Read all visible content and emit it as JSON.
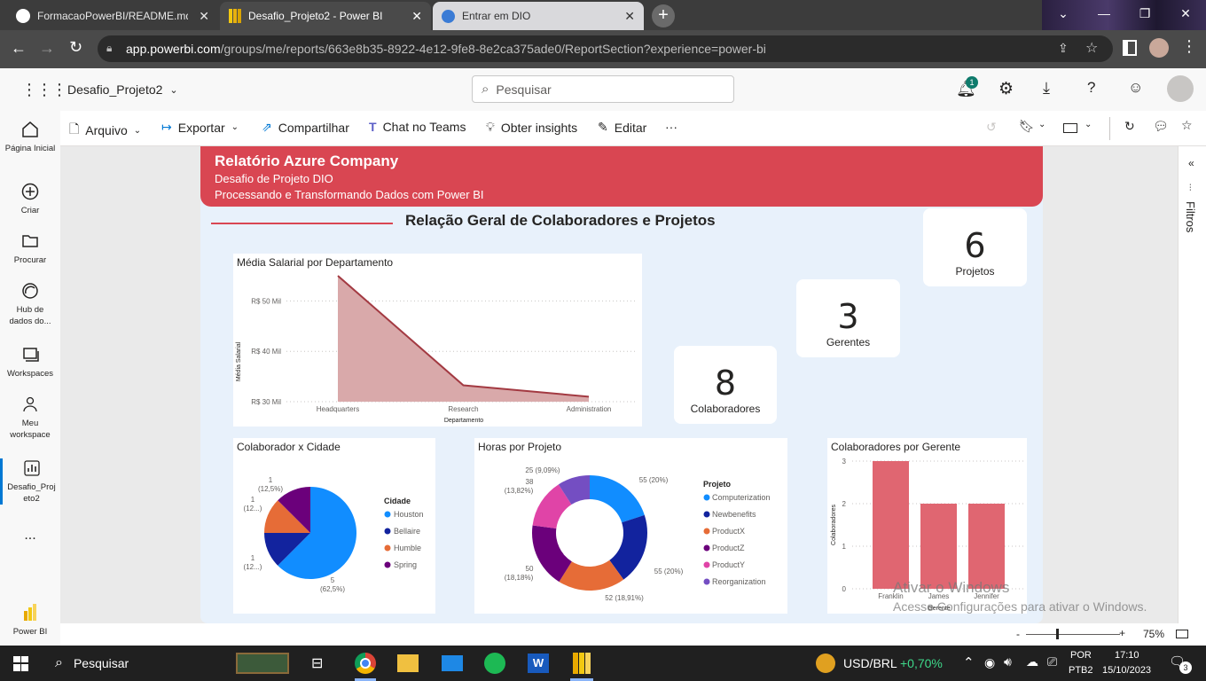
{
  "browser": {
    "tabs": [
      {
        "title": "FormacaoPowerBI/README.md"
      },
      {
        "title": "Desafio_Projeto2 - Power BI"
      },
      {
        "title": "Entrar em DIO"
      }
    ],
    "url_domain": "app.powerbi.com",
    "url_path": "/groups/me/reports/663e8b35-8922-4e12-9fe8-8e2ca375ade0/ReportSection?experience=power-bi"
  },
  "header": {
    "report_name": "Desafio_Projeto2",
    "search_placeholder": "Pesquisar",
    "notification_count": "1"
  },
  "leftnav": {
    "items": [
      {
        "label": "Página Inicial"
      },
      {
        "label": "Criar"
      },
      {
        "label": "Procurar"
      },
      {
        "label": "Hub de dados do..."
      },
      {
        "label": "Workspaces"
      },
      {
        "label": "Meu workspace"
      },
      {
        "label": "Desafio_Projeto2"
      },
      {
        "label": "Power BI"
      }
    ],
    "more": "..."
  },
  "toolbar": {
    "file": "Arquivo",
    "export": "Exportar",
    "share": "Compartilhar",
    "teams": "Chat no Teams",
    "insights": "Obter insights",
    "edit": "Editar",
    "more": "···"
  },
  "banner": {
    "title": "Relatório Azure Company",
    "line1": "Desafio de Projeto DIO",
    "line2": "Processando e Transformando Dados com Power BI"
  },
  "report": {
    "heading": "Relação Geral de Colaboradores e Projetos",
    "cards": [
      {
        "value": "6",
        "label": "Projetos"
      },
      {
        "value": "3",
        "label": "Gerentes"
      },
      {
        "value": "8",
        "label": "Colaboradores"
      }
    ]
  },
  "chart_data": [
    {
      "type": "area",
      "title": "Média Salarial por Departamento",
      "xlabel": "Departamento",
      "ylabel": "Média Salarial",
      "categories": [
        "Headquarters",
        "Research",
        "Administration"
      ],
      "values": [
        55000,
        33250,
        31000
      ],
      "ytick_labels": [
        "R$ 50 Mil",
        "R$ 40 Mil",
        "R$ 30 Mil"
      ],
      "ylim": [
        30000,
        55000
      ],
      "color": "#a33a42"
    },
    {
      "type": "pie",
      "title": "Colaborador x Cidade",
      "legend_title": "Cidade",
      "categories": [
        "Houston",
        "Bellaire",
        "Humble",
        "Spring"
      ],
      "values": [
        5,
        1,
        1,
        1
      ],
      "labels": [
        "5 (62,5%)",
        "1 (12...)",
        "1 (12...)",
        "1 (12,5%)"
      ],
      "colors": [
        "#118dff",
        "#12239e",
        "#e66c37",
        "#6b007b"
      ]
    },
    {
      "type": "pie",
      "title": "Horas por Projeto",
      "legend_title": "Projeto",
      "categories": [
        "Computerization",
        "Newbenefits",
        "ProductX",
        "ProductZ",
        "ProductY",
        "Reorganization"
      ],
      "values": [
        55,
        55,
        52,
        50,
        38,
        25
      ],
      "labels": [
        "55 (20%)",
        "55 (20%)",
        "52 (18,91%)",
        "50 (18,18%)",
        "38 (13,82%)",
        "25 (9,09%)"
      ],
      "colors": [
        "#118dff",
        "#12239e",
        "#e66c37",
        "#6b007b",
        "#e044a7",
        "#744ec2"
      ]
    },
    {
      "type": "bar",
      "title": "Colaboradores por Gerente",
      "xlabel": "Gerente",
      "ylabel": "Colaboradores",
      "categories": [
        "Franklin",
        "James",
        "Jennifer"
      ],
      "values": [
        3,
        2,
        2
      ],
      "ylim": [
        0,
        3
      ],
      "yticks": [
        "3",
        "2",
        "1",
        "0"
      ],
      "color": "#e06671"
    }
  ],
  "filters": {
    "label": "Filtros"
  },
  "status": {
    "zoom": "75%"
  },
  "watermark": {
    "line1": "Ativar o Windows",
    "line2": "Acesse Configurações para ativar o Windows."
  },
  "taskbar": {
    "search": "Pesquisar",
    "currency": "USD/BRL",
    "currency_change": "+0,70%",
    "lang1": "POR",
    "lang2": "PTB2",
    "time": "17:10",
    "date": "15/10/2023",
    "notif": "3"
  }
}
